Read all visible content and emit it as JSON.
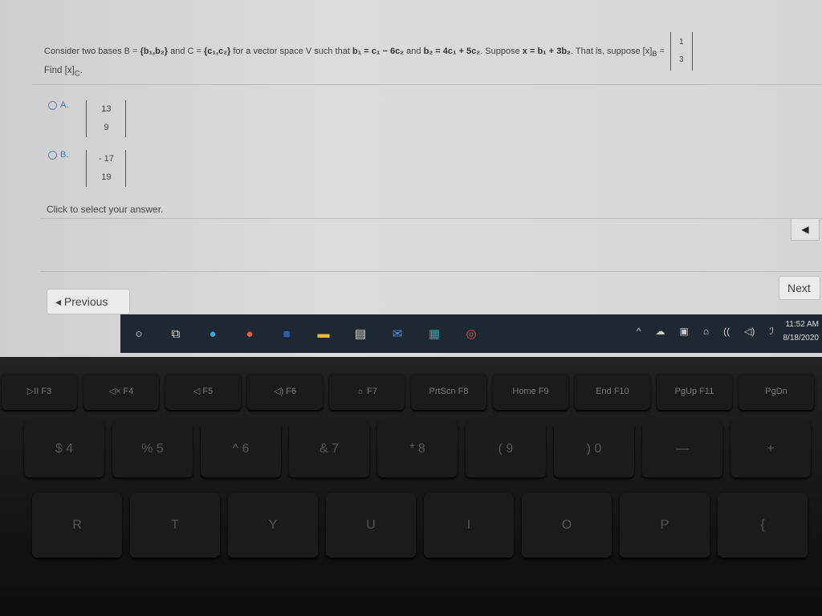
{
  "question": {
    "prefix": "Consider two bases B =",
    "setB": "{b₁,b₂}",
    "and": "and C =",
    "setC": "{c₁,c₂}",
    "middle": "for a vector space V such that",
    "eq1": "b₁ = c₁ − 6c₂",
    "and2": "and",
    "eq2": "b₂ = 4c₁ + 5c₂",
    "suppose": ". Suppose",
    "eq3": "x = b₁ + 3b₂",
    "thatis": ". That is, suppose [x]",
    "sub": "B",
    "equals": "=",
    "vec": [
      "1",
      "3"
    ],
    "find": "Find [x]",
    "find_sub": "C",
    "find_end": "."
  },
  "options": [
    {
      "letter": "A.",
      "values": [
        "13",
        "9"
      ]
    },
    {
      "letter": "B.",
      "values": [
        "- 17",
        "19"
      ]
    }
  ],
  "hint": "Click to select your answer.",
  "nav": {
    "previous": "◂ Previous",
    "next": "Next",
    "arrow": "◀"
  },
  "taskbar": {
    "icons": [
      "cortana-icon",
      "task-view-icon",
      "edge-icon",
      "firefox-icon",
      "word-icon",
      "file-explorer-icon",
      "store-icon",
      "mail-icon",
      "calculator-icon",
      "app-icon"
    ],
    "tray": [
      "^",
      "☁",
      "▣",
      "⌂",
      "((",
      "◁)",
      "ℐ"
    ],
    "time": "11:52 AM",
    "date": "8/18/2020"
  },
  "keyboard": {
    "fkeys": [
      "▷II F3",
      "◁× F4",
      "◁ F5",
      "◁) F6",
      "☼ F7",
      "PrtScn F8",
      "Home F9",
      "End F10",
      "PgUp F11",
      "PgDn"
    ],
    "numrow": [
      "$ 4",
      "% 5",
      "^ 6",
      "& 7",
      "* 8",
      "( 9",
      ") 0",
      "—",
      "+"
    ],
    "letters": [
      "R",
      "T",
      "Y",
      "U",
      "I",
      "O",
      "P",
      "{"
    ]
  }
}
